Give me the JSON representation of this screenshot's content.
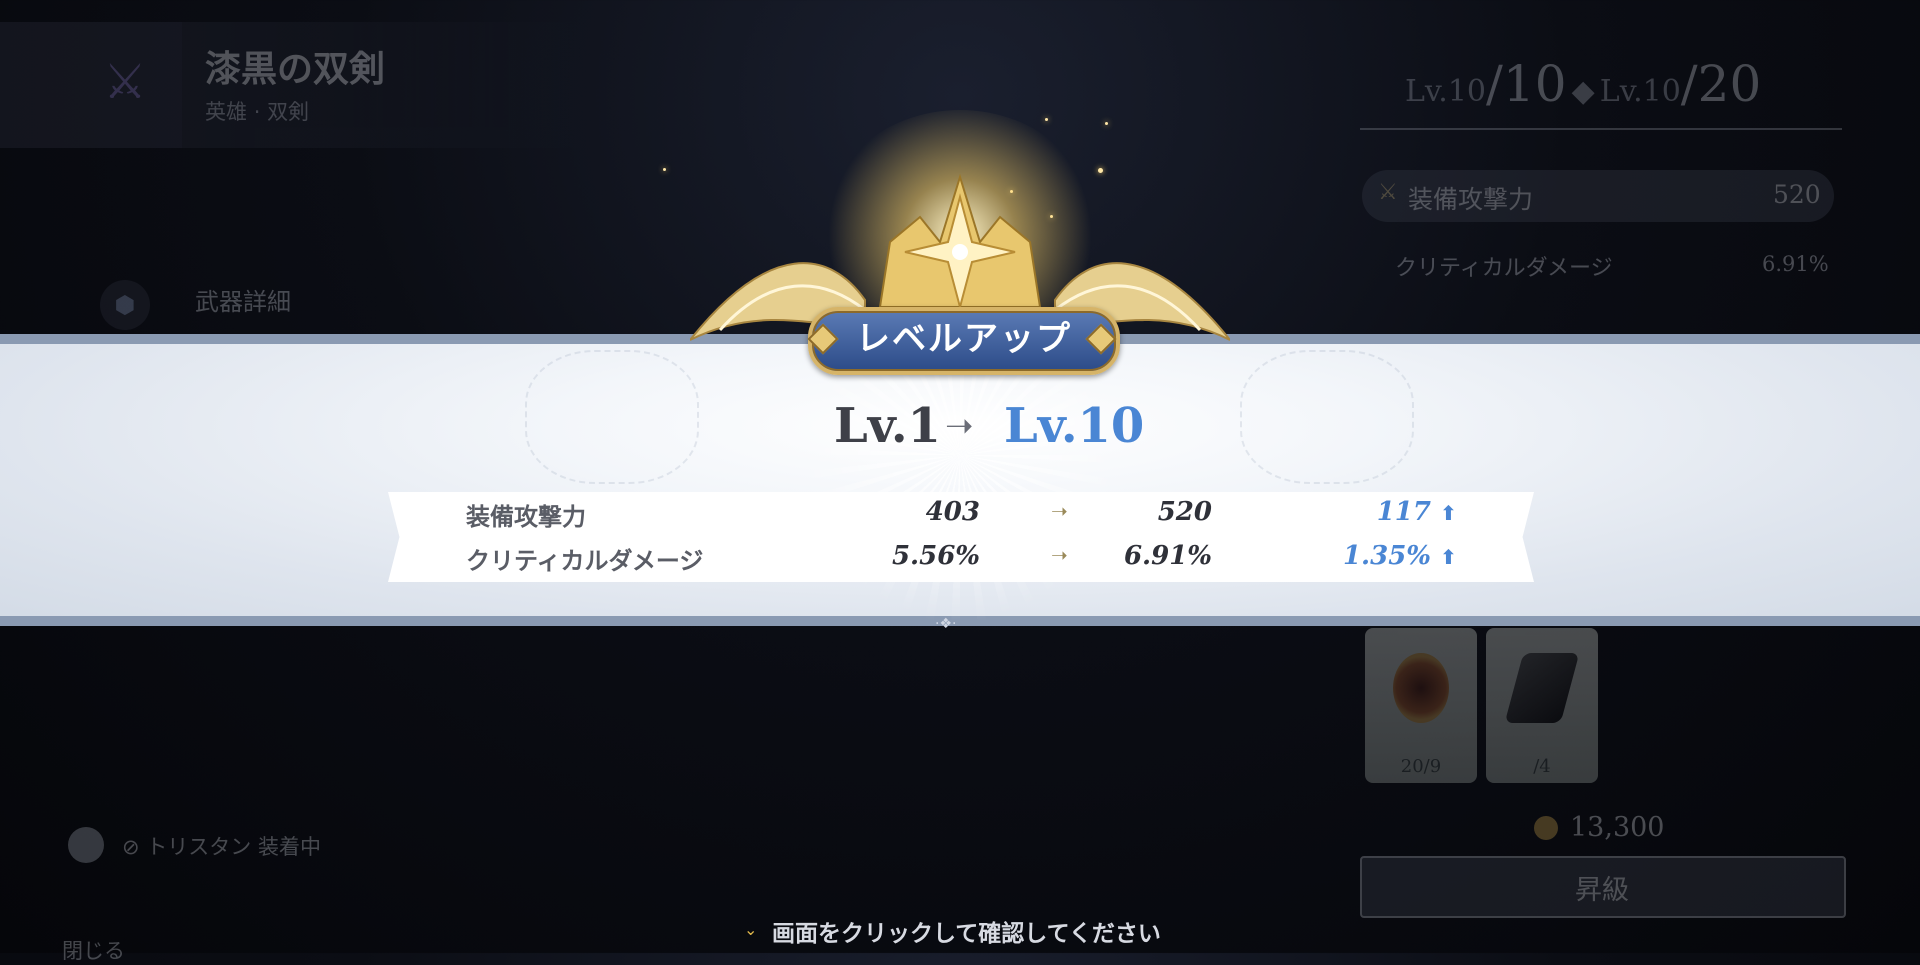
{
  "background": {
    "weapon": {
      "name": "漆黒の双剣",
      "rarity": "英雄",
      "separator": "·",
      "category": "双剣"
    },
    "detail_label": "武器詳細",
    "level_display": {
      "current_small": "Lv.10",
      "current_big": "/10",
      "cap_small": "Lv.10",
      "cap_big": "/20",
      "separator": "◆"
    },
    "main_stat": {
      "label": "装備攻撃力",
      "value": "520"
    },
    "sub_stat": {
      "label": "クリティカルダメージ",
      "value": "6.91%"
    },
    "materials": [
      {
        "icon": "eye-gem-icon",
        "count": "20/9"
      },
      {
        "icon": "ingot-icon",
        "count": "/4"
      }
    ],
    "gold": "13,300",
    "upgrade_button": "昇級",
    "equipped_text": "⊘ トリスタン 装着中",
    "close_label": "閉じる"
  },
  "level_up": {
    "title": "レベルアップ",
    "from_level": "Lv.1",
    "arrow": "➝",
    "to_level": "Lv.10",
    "stats": [
      {
        "label": "装備攻撃力",
        "from": "403",
        "arrow": "➝",
        "to": "520",
        "diff": "117",
        "up": "⬆"
      },
      {
        "label": "クリティカルダメージ",
        "from": "5.56%",
        "arrow": "➝",
        "to": "6.91%",
        "diff": "1.35%",
        "up": "⬆"
      }
    ]
  },
  "hint": {
    "icon": "⌄",
    "text": "画面をクリックして確認してください"
  },
  "colors": {
    "accent_blue": "#4a86d4",
    "gold": "#d6b468",
    "plate_blue": "#2c4b88"
  }
}
